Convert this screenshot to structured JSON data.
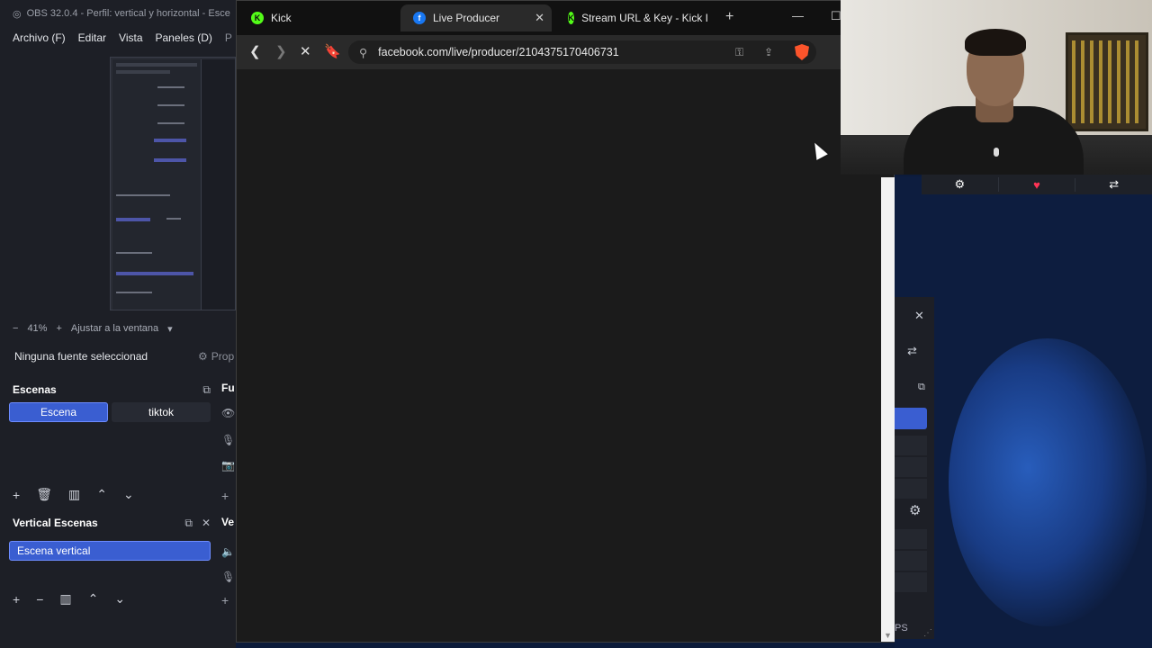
{
  "obs": {
    "title": "OBS 32.0.4 - Perfil: vertical y horizontal - Esce",
    "menu": [
      "Archivo (F)",
      "Editar",
      "Vista",
      "Paneles (D)",
      "P"
    ],
    "zoom_label": "41%",
    "fit_label": "Ajustar a la ventana",
    "no_source": "Ninguna fuente seleccionad",
    "props_label": "Prop",
    "scenes_title": "Escenas",
    "scenes": [
      "Escena",
      "tiktok"
    ],
    "sources_title": "Fu",
    "vertical_title": "Vertical Escenas",
    "vertical_scenes": [
      "Escena vertical"
    ],
    "vertical_right_title": "Ve"
  },
  "browser": {
    "tabs": [
      {
        "label": "Kick",
        "icon": "kick-icon",
        "active": false
      },
      {
        "label": "Live Producer",
        "icon": "facebook-icon",
        "active": true
      },
      {
        "label": "Stream URL & Key - Kick I",
        "icon": "kick-icon",
        "active": false
      }
    ],
    "url": "facebook.com/live/producer/2104375170406731",
    "status_fragment": "PS"
  },
  "colors": {
    "accent": "#3a5ed1",
    "kick": "#53fc18",
    "facebook": "#1877f2",
    "brave": "#fb542b"
  }
}
